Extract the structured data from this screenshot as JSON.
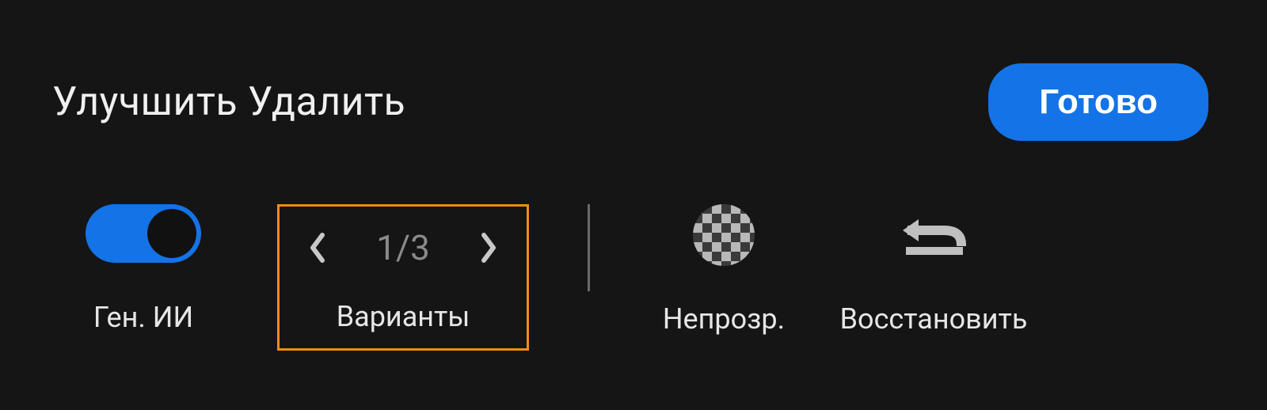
{
  "header": {
    "title": "Улучшить Удалить",
    "done_label": "Готово"
  },
  "controls": {
    "gen_ai": {
      "label": "Ген. ИИ",
      "enabled": true
    },
    "variants": {
      "label": "Варианты",
      "current": 1,
      "total": 3,
      "counter_text": "1/3"
    },
    "opacity": {
      "label": "Непрозр."
    },
    "reset": {
      "label": "Восстановить"
    }
  },
  "colors": {
    "accent": "#1473e6",
    "highlight_border": "#f08c1a",
    "background": "#151515"
  }
}
